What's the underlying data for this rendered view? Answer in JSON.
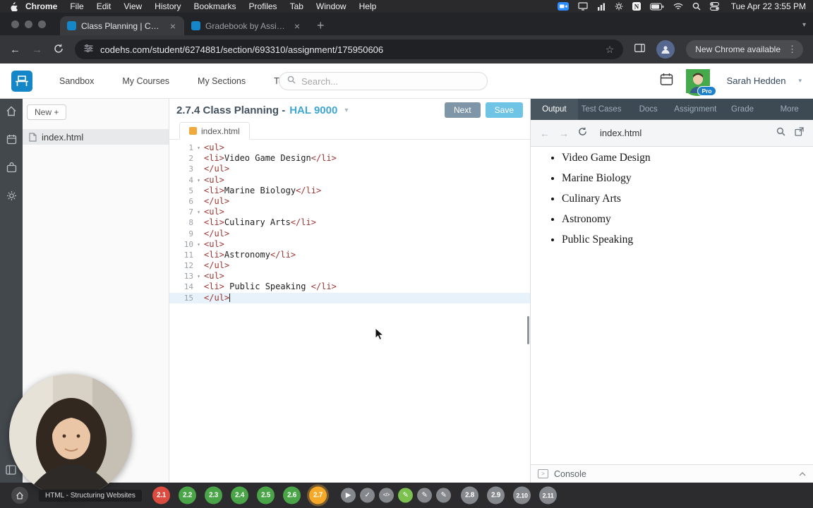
{
  "colors": {
    "tag": "#9c3530",
    "codehs_blue": "#1587c9",
    "accent_blue": "#3ea6d4",
    "badge_red": "#db4b3f",
    "badge_green": "#4aa448",
    "badge_yellow": "#f6a828",
    "badge_gray": "#85898d",
    "badge_green_light": "#7cc050"
  },
  "menubar": {
    "app": "Chrome",
    "items": [
      "File",
      "Edit",
      "View",
      "History",
      "Bookmarks",
      "Profiles",
      "Tab",
      "Window",
      "Help"
    ],
    "clock": "Tue Apr 22  3:55 PM"
  },
  "browser": {
    "tabs": [
      {
        "title": "Class Planning | CodeHS",
        "active": true
      },
      {
        "title": "Gradebook by Assignment: C",
        "active": false
      }
    ],
    "url": "codehs.com/student/6274881/section/693310/assignment/175950606",
    "update_label": "New Chrome available"
  },
  "header": {
    "nav": [
      "Sandbox",
      "My Courses",
      "My Sections",
      "Toolbox"
    ],
    "search_placeholder": "Search...",
    "pro_badge": "Pro",
    "user_name": "Sarah Hedden"
  },
  "sidebar": {
    "new_button": "New +",
    "files": [
      "index.html"
    ]
  },
  "editor": {
    "title": "2.7.4 Class Planning -",
    "subtitle": "HAL 9000",
    "next_label": "Next",
    "save_label": "Save",
    "tab": "index.html",
    "code_lines": [
      "<ul>",
      "<li>Video Game Design</li>",
      "</ul>",
      "<ul>",
      "<li>Marine Biology</li>",
      "</ul>",
      "<ul>",
      "<li>Culinary Arts</li>",
      "</ul>",
      "<ul>",
      "<li>Astronomy</li>",
      "</ul>",
      "<ul>",
      "<li> Public Speaking </li>",
      "</ul>"
    ],
    "fold_lines": [
      1,
      4,
      7,
      10,
      13
    ],
    "active_line": 15
  },
  "output_panel": {
    "tabs": [
      "Output",
      "Test Cases",
      "Docs",
      "Assignment",
      "Grade",
      "More"
    ],
    "active_tab": "Output",
    "address": "index.html",
    "list_items": [
      "Video Game Design",
      "Marine Biology",
      "Culinary Arts",
      "Astronomy",
      "Public Speaking"
    ],
    "console_label": "Console"
  },
  "bottombar": {
    "module_label": "HTML - Structuring Websites",
    "badges": [
      {
        "label": "2.1",
        "color": "red"
      },
      {
        "label": "2.2",
        "color": "green"
      },
      {
        "label": "2.3",
        "color": "green"
      },
      {
        "label": "2.4",
        "color": "green"
      },
      {
        "label": "2.5",
        "color": "green"
      },
      {
        "label": "2.6",
        "color": "green"
      },
      {
        "label": "2.7",
        "color": "yellow",
        "current": true
      },
      {
        "icon": "video",
        "color": "gray",
        "gap": true
      },
      {
        "icon": "check",
        "color": "gray"
      },
      {
        "icon": "example",
        "color": "gray"
      },
      {
        "icon": "pencil",
        "color": "green_light"
      },
      {
        "icon": "pencil",
        "color": "gray"
      },
      {
        "icon": "pencil",
        "color": "gray"
      },
      {
        "label": "2.8",
        "color": "gray",
        "gap": true
      },
      {
        "label": "2.9",
        "color": "gray"
      },
      {
        "label": "2.10",
        "color": "gray"
      },
      {
        "label": "2.11",
        "color": "gray"
      }
    ]
  }
}
